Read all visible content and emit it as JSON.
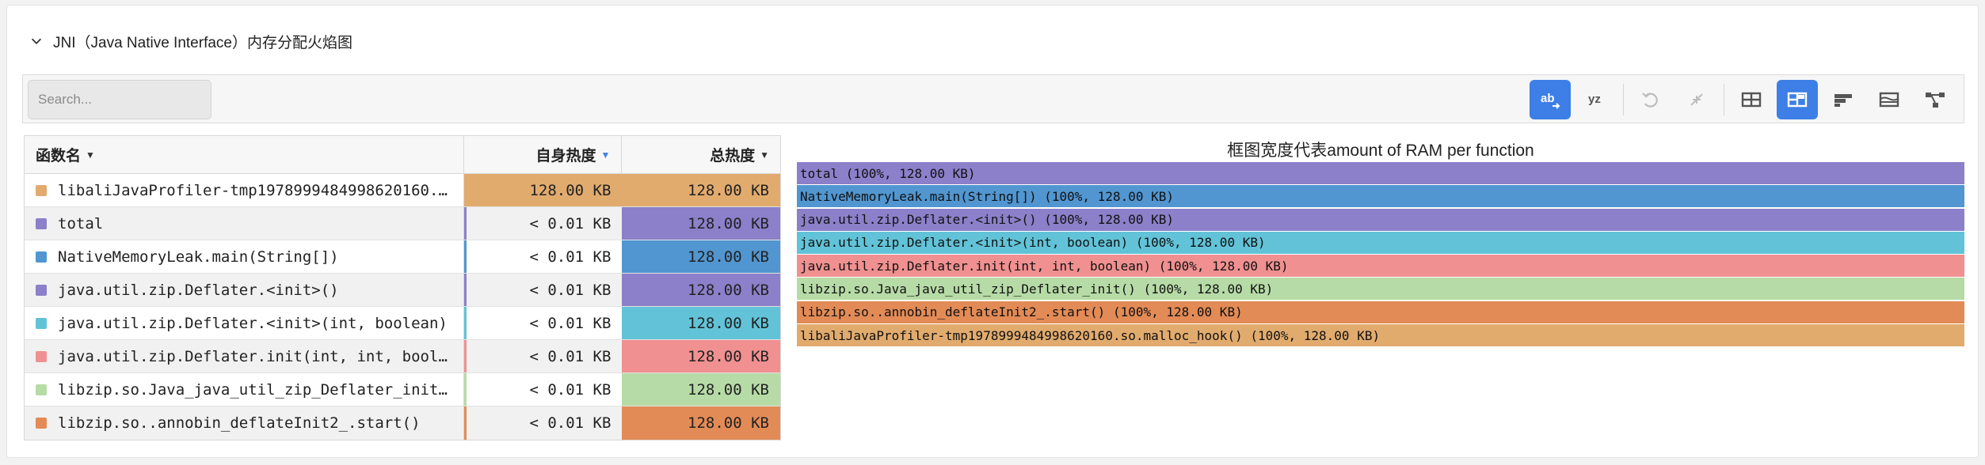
{
  "section": {
    "title": "JNI（Java Native Interface）内存分配火焰图"
  },
  "search": {
    "placeholder": "Search..."
  },
  "toolbar": {
    "buttons": [
      {
        "icon": "ab-icon",
        "label": "ab",
        "state": "active"
      },
      {
        "icon": "yz-icon",
        "label": "yz",
        "state": "normal"
      },
      {
        "icon": "undo-icon",
        "state": "disabled"
      },
      {
        "icon": "compress-icon",
        "state": "disabled"
      },
      {
        "icon": "table-view-icon",
        "state": "normal"
      },
      {
        "icon": "table-flame-view-icon",
        "state": "active"
      },
      {
        "icon": "flame-graph-icon",
        "state": "normal"
      },
      {
        "icon": "sandwich-icon",
        "state": "normal"
      },
      {
        "icon": "call-tree-icon",
        "state": "normal"
      }
    ]
  },
  "table": {
    "headers": {
      "name": "函数名",
      "self": "自身热度",
      "total": "总热度"
    },
    "rows": [
      {
        "name": "libaliJavaProfiler-tmp1978999484998620160.so.malloc_hook()",
        "self": "128.00 KB",
        "total": "128.00 KB",
        "color": "#e2ab6e"
      },
      {
        "name": "total",
        "self": "< 0.01 KB",
        "total": "128.00 KB",
        "color": "#8b80c9"
      },
      {
        "name": "NativeMemoryLeak.main(String[])",
        "self": "< 0.01 KB",
        "total": "128.00 KB",
        "color": "#5196d0"
      },
      {
        "name": "java.util.zip.Deflater.<init>()",
        "self": "< 0.01 KB",
        "total": "128.00 KB",
        "color": "#8b80c9"
      },
      {
        "name": "java.util.zip.Deflater.<init>(int, boolean)",
        "self": "< 0.01 KB",
        "total": "128.00 KB",
        "color": "#62c3d8"
      },
      {
        "name": "java.util.zip.Deflater.init(int, int, boolean)",
        "self": "< 0.01 KB",
        "total": "128.00 KB",
        "color": "#f09090"
      },
      {
        "name": "libzip.so.Java_java_util_zip_Deflater_init()",
        "self": "< 0.01 KB",
        "total": "128.00 KB",
        "color": "#b7dba6"
      },
      {
        "name": "libzip.so..annobin_deflateInit2_.start()",
        "self": "< 0.01 KB",
        "total": "128.00 KB",
        "color": "#e38b56"
      }
    ]
  },
  "flame": {
    "title": "框图宽度代表amount of RAM per function",
    "frames": [
      {
        "label": "total (100%, 128.00 KB)",
        "color": "#8b80c9"
      },
      {
        "label": "NativeMemoryLeak.main(String[]) (100%, 128.00 KB)",
        "color": "#5196d0"
      },
      {
        "label": "java.util.zip.Deflater.<init>() (100%, 128.00 KB)",
        "color": "#8b80c9"
      },
      {
        "label": "java.util.zip.Deflater.<init>(int, boolean) (100%, 128.00 KB)",
        "color": "#62c3d8"
      },
      {
        "label": "java.util.zip.Deflater.init(int, int, boolean) (100%, 128.00 KB)",
        "color": "#f09090"
      },
      {
        "label": "libzip.so.Java_java_util_zip_Deflater_init() (100%, 128.00 KB)",
        "color": "#b7dba6"
      },
      {
        "label": "libzip.so..annobin_deflateInit2_.start() (100%, 128.00 KB)",
        "color": "#e38b56"
      },
      {
        "label": "libaliJavaProfiler-tmp1978999484998620160.so.malloc_hook() (100%, 128.00 KB)",
        "color": "#e2ab6e"
      }
    ]
  }
}
